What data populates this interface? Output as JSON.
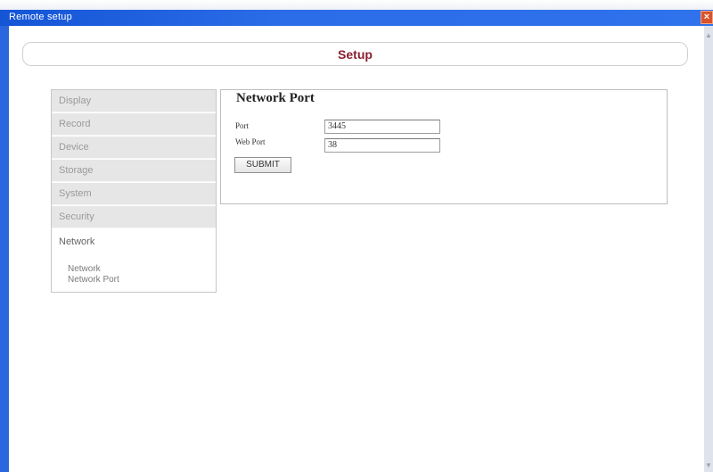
{
  "window": {
    "title": "Remote setup",
    "close_glyph": "×"
  },
  "header": {
    "title": "Setup"
  },
  "sidebar": {
    "items": [
      {
        "label": "Display"
      },
      {
        "label": "Record"
      },
      {
        "label": "Device"
      },
      {
        "label": "Storage"
      },
      {
        "label": "System"
      },
      {
        "label": "Security"
      },
      {
        "label": "Network"
      }
    ],
    "sub_items": [
      {
        "label": "Network"
      },
      {
        "label": "Network Port"
      }
    ]
  },
  "content": {
    "title": "Network Port",
    "fields": [
      {
        "label": "Port",
        "value": "3445"
      },
      {
        "label": "Web Port",
        "value": "38"
      }
    ],
    "submit_label": "SUBMIT"
  },
  "scrollbar": {
    "up_glyph": "▲",
    "down_glyph": "▼"
  },
  "colors": {
    "title_bar": "#2b6ce8",
    "header_title": "#8a1f2f",
    "close_button": "#d9532b"
  }
}
